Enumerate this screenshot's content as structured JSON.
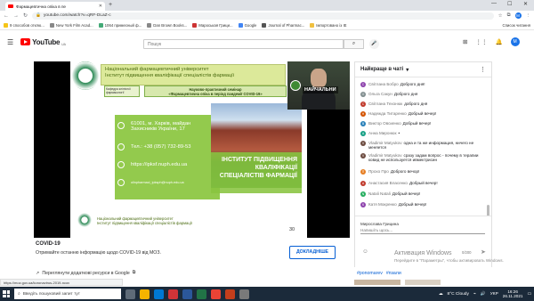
{
  "browser": {
    "tab_title": "Фармацевтична опіка в пе",
    "url": "youtube.com/watch?v=qRF-DLaZ-c",
    "bookmarks": [
      "9 способов отклю...",
      "New York Film Acad...",
      "1064 примесный ф...",
      "Dan Brown Books...",
      "Мароськая Грици...",
      "Google",
      "Journal of Pharmac...",
      "Імпортовано із IE"
    ],
    "bookmarks_right": "Список читання",
    "profile_initial": "M"
  },
  "youtube": {
    "logo": "YouTube",
    "region": "UA",
    "search_placeholder": "Пошук",
    "avatar_initial": "M"
  },
  "slide": {
    "header_line1": "Національний фармацевтичний університет",
    "header_line2": "Інститут підвищення кваліфікації спеціалістів фармації",
    "box_left": "Кафедра клінічної фармакології",
    "box_right_line1": "Науково-практичний семінар",
    "box_right_line2": "«Фармацевтична опіка в період пандемії COVID-19»",
    "address": "61001, м. Харків, майдан Захисників України, 17",
    "phone": "Тел.: +38 (057) 732-89-53",
    "site": "https://ipksf.nuph.edu.ua",
    "email": "olinpharmaci_ipksph@nuph.edu.ua",
    "banner_line1": "ІНСТИТУТ ПІДВИЩЕННЯ",
    "banner_line2": "КВАЛІФІКАЦІЇ",
    "banner_line3": "СПЕЦІАЛІСТІВ ФАРМАЦІЇ",
    "footer_line1": "Національний фармацевтичний університет",
    "footer_line2": "Інститут підвищення кваліфікації спеціалістів фармації",
    "page_number": "30"
  },
  "webcam": {
    "label": "НАЙЧАЛЬНИ"
  },
  "info_card": {
    "title": "COVID-19",
    "desc": "Отримайте останню інформацію щодо COVID-19 від МОЗ.",
    "source": "Переглянути додаткові ресурси в Google",
    "button": "ДОКЛАДНІШЕ"
  },
  "status_url": "https://moz.gov.ua/koronavirus-2019-ncov",
  "chat": {
    "header": "Найкраще в чаті",
    "messages": [
      {
        "author": "Світлана Бобро",
        "text": "Доброго дня!",
        "color": "#8e44ad",
        "initial": "С"
      },
      {
        "author": "Ольга Сакун",
        "text": "Доброго дня",
        "color": "#7f8c8d",
        "initial": "О"
      },
      {
        "author": "Світлана Техонюк",
        "text": "доброго дня",
        "color": "#c0392b",
        "initial": "С"
      },
      {
        "author": "Надежда Титаренко",
        "text": "Добрый вечер!",
        "color": "#d35400",
        "initial": "Н"
      },
      {
        "author": "Виктор Овсиенко",
        "text": "Добрый вечер!",
        "color": "#2980b9",
        "initial": "В"
      },
      {
        "author": "Анна Миронюк",
        "text": "•",
        "color": "#16a085",
        "initial": "А"
      },
      {
        "author": "Vladimir Matyukov",
        "text": "одна и та же информация, ничего не меняется",
        "color": "#6d4c41",
        "initial": "V"
      },
      {
        "author": "Vladimir Matyukov",
        "text": "сразу задам вопрос - почему в терапии ковид не используется ивмектрисин",
        "color": "#6d4c41",
        "initial": "V"
      },
      {
        "author": "Прохо Про",
        "text": "Доброго вечор!",
        "color": "#e67e22",
        "initial": "П"
      },
      {
        "author": "Анастасия Власенко",
        "text": "Добрый вечер!",
        "color": "#c0392b",
        "initial": "А"
      },
      {
        "author": "Natali Natali",
        "text": "Добрый вечер!",
        "color": "#27ae60",
        "initial": "N"
      },
      {
        "author": "Катя Мокренко",
        "text": "Добрый вечер!",
        "color": "#8e44ad",
        "initial": "К"
      }
    ],
    "input_name": "Мирослава Грицина",
    "input_placeholder": "Напишіть щось...",
    "counter": "0/200"
  },
  "tags": [
    "#ponomarev",
    "#пзали"
  ],
  "activation": {
    "title": "Активация Windows",
    "sub": "Перейдите в \"Параметры\", чтобы активировать Windows."
  },
  "taskbar": {
    "search": "Введіть пошуковий запит тут",
    "weather": "8°C Cloudy",
    "lang": "УКР",
    "time": "16:26",
    "date": "26.11.2021"
  }
}
